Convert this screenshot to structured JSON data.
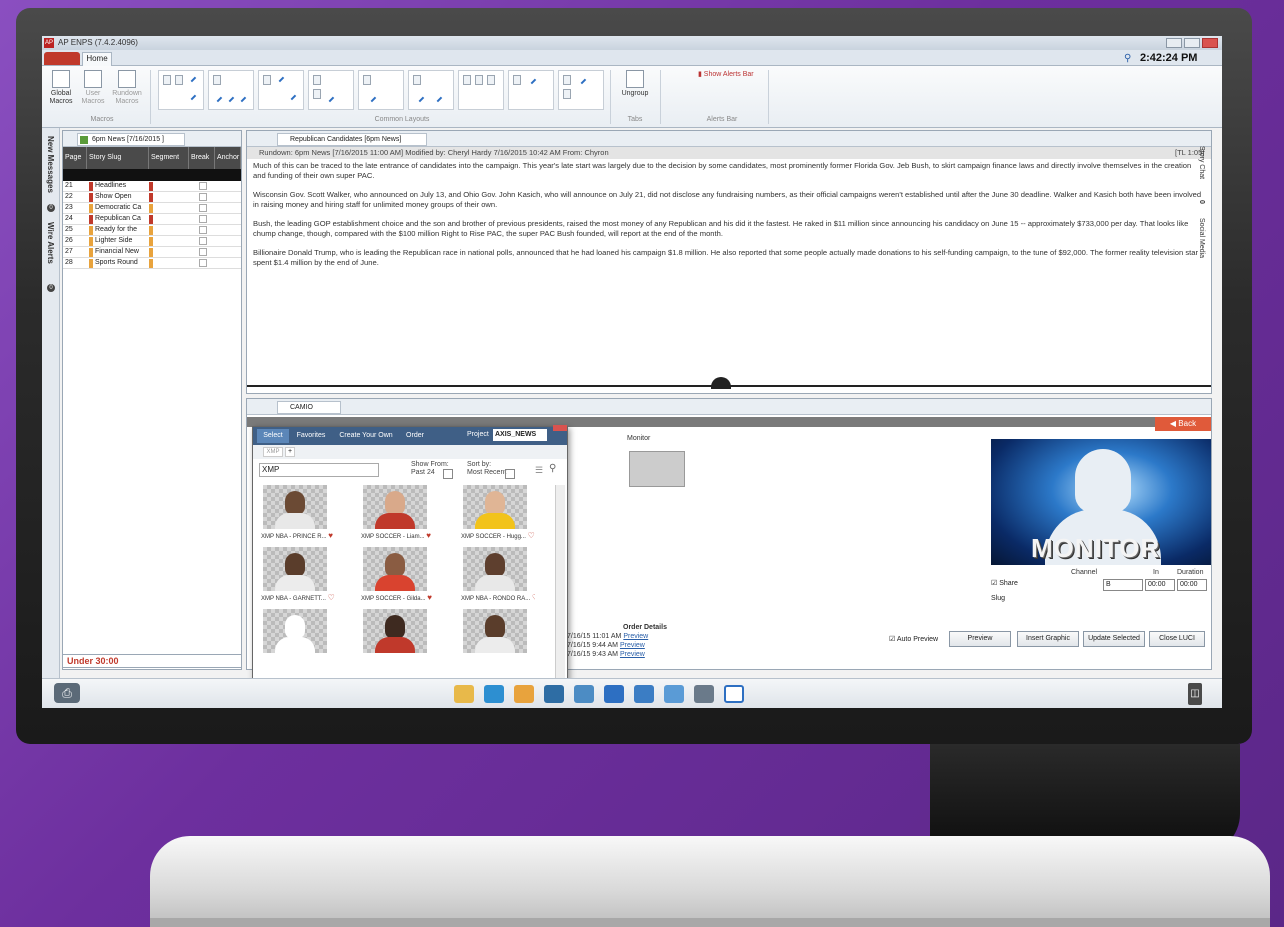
{
  "window": {
    "title": "AP ENPS (7.4.2.4096)"
  },
  "ribbon": {
    "tab_home": "Home",
    "global_macros": "Global Macros",
    "user_macros": "User Macros",
    "rundown_macros": "Rundown Macros",
    "macros_group": "Macros",
    "common_layouts_group": "Common Layouts",
    "ungroup": "Ungroup",
    "tabs_group": "Tabs",
    "show_alerts_bar": "Show Alerts Bar",
    "alerts_bar_group": "Alerts Bar"
  },
  "clock": "2:42:24 PM",
  "left_strip": {
    "messages": "New Messages",
    "messages_count": "0",
    "wire_alerts": "Wire Alerts",
    "alerts_count": "0"
  },
  "rundown": {
    "tab_title": "6pm News [7/16/2015 ]",
    "headers": [
      "Page",
      "Story Slug",
      "Segment",
      "Break",
      "Anchor"
    ],
    "rows": [
      {
        "page": "21",
        "slug": "Headlines",
        "color": "#c0392b"
      },
      {
        "page": "22",
        "slug": "Show Open",
        "color": "#c0392b"
      },
      {
        "page": "23",
        "slug": "Democratic Ca",
        "color": "#e8a33d"
      },
      {
        "page": "24",
        "slug": "Republican Ca",
        "color": "#c0392b"
      },
      {
        "page": "25",
        "slug": "Ready for the",
        "color": "#e8a33d"
      },
      {
        "page": "26",
        "slug": "Lighter Side",
        "color": "#e8a33d"
      },
      {
        "page": "27",
        "slug": "Financial New",
        "color": "#e8a33d"
      },
      {
        "page": "28",
        "slug": "Sports Round",
        "color": "#e8a33d"
      }
    ],
    "under_label": "Under 30:00"
  },
  "story": {
    "tab_title": "Republican Candidates [6pm News]",
    "meta": "Rundown: 6pm News [7/16/2015 11:00 AM]   Modified by: Cheryl Hardy   7/16/2015 10:42 AM   From: Chyron",
    "tl": "[TL 1:05]",
    "paragraphs": [
      "Much of this can be traced to the late entrance of candidates into the campaign. This year's late start was largely due to the decision by some candidates, most prominently former Florida Gov. Jeb Bush, to skirt campaign finance laws and directly involve themselves in the creation and funding of their own super PAC.",
      "Wisconsin Gov. Scott Walker, who announced on July 13, and Ohio Gov. John Kasich, who will announce on July 21, did not disclose any fundraising numbers, as their official campaigns weren't established until after the June 30 deadline. Walker and Kasich both have been involved in raising money and hiring staff for unlimited money groups of their own.",
      "Bush, the leading GOP establishment choice and the son and brother of previous presidents, raised the most money of any Republican and his did it the fastest. He raked in $11 million since announcing his candidacy on June 15 -- approximately $733,000 per day. That looks like chump change, though, compared with the $100 million Right to Rise PAC, the super PAC Bush founded, will report at the end of the month.",
      "Billionaire Donald Trump, who is leading the Republican race in national polls, announced that he had loaned his campaign $1.8 million. He also reported that some people actually made donations to his self-funding campaign, to the tune of $92,000. The former reality television star spent $1.4 million by the end of June."
    ]
  },
  "right_strip": {
    "story_chat": "Story Chat",
    "chat_count": "0",
    "social_media": "Social Media"
  },
  "camio": {
    "tab_title": "CAMIO",
    "back": "Back",
    "monitor_label": "Monitor",
    "preview_text": "MONITOR",
    "channel_label": "Channel",
    "in_label": "In",
    "duration_label": "Duration",
    "share_label": "Share",
    "channel_value": "B",
    "in_value": "00:00",
    "duration_value": "00:00",
    "slug_label": "Slug",
    "auto_preview": "Auto Preview",
    "buttons": [
      "Preview",
      "Insert Graphic",
      "Update Selected",
      "Close LUCI"
    ],
    "order_title": "Order Details",
    "orders": [
      {
        "time": "7/16/15 11:01 AM",
        "link": "Preview"
      },
      {
        "time": "7/16/15 9:44 AM",
        "link": "Preview"
      },
      {
        "time": "7/16/15 9:43 AM",
        "link": "Preview"
      }
    ]
  },
  "asset_dialog": {
    "tabs": [
      "Select",
      "Favorites",
      "Create Your Own",
      "Order"
    ],
    "project_label": "Project",
    "project_value": "AXIS_NEWS",
    "chip_xmp": "XMP",
    "search_value": "XMP",
    "show_from_label": "Show From:",
    "show_from_value": "Past 24",
    "sort_by_label": "Sort by:",
    "sort_by_value": "Most Recent",
    "thumbs": [
      {
        "caption": "XMP NBA - PRINCE R...",
        "face": "#6b4a34",
        "jersey": "#e8e8e8",
        "fav": true
      },
      {
        "caption": "XMP SOCCER - Liam...",
        "face": "#d9a98a",
        "jersey": "#c0392b",
        "fav": true
      },
      {
        "caption": "XMP SOCCER - Hugg...",
        "face": "#e0b595",
        "jersey": "#f2c31b",
        "fav": false
      },
      {
        "caption": "XMP NBA - GARNETT...",
        "face": "#5a3d2b",
        "jersey": "#ececec",
        "fav": false
      },
      {
        "caption": "XMP SOCCER - Gilda...",
        "face": "#8a5c42",
        "jersey": "#d9432f",
        "fav": true
      },
      {
        "caption": "XMP NBA - RONDO RA...",
        "face": "#5e3f2e",
        "jersey": "#e8e8e8",
        "fav": false
      },
      {
        "caption": "",
        "face": "#ffffff",
        "jersey": "#ffffff",
        "fav": false
      },
      {
        "caption": "",
        "face": "#3e2a20",
        "jersey": "#c0392b",
        "fav": false
      },
      {
        "caption": "",
        "face": "#5a3d2b",
        "jersey": "#ececec",
        "fav": false
      }
    ]
  },
  "colors": {
    "accent": "#2d6fc2",
    "alert": "#c0392b",
    "back_button": "#e05a3a"
  }
}
